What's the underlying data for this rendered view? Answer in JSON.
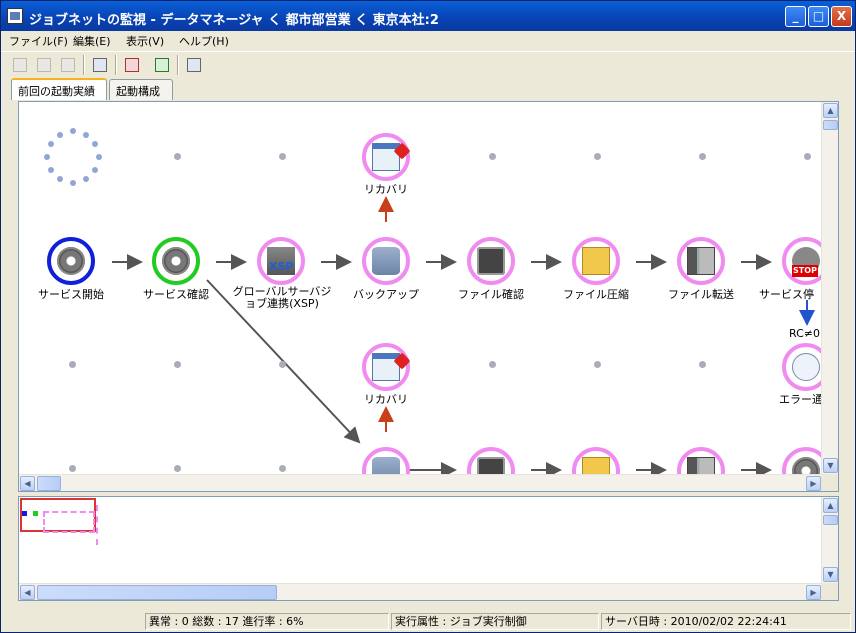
{
  "window": {
    "title": "ジョブネットの監視 - データマネージャ く 都市部営業 く 東京本社:2"
  },
  "title_buttons": {
    "minimize": "_",
    "maximize": "□",
    "close": "X"
  },
  "menu": [
    "ファイル(F)",
    "編集(E)",
    "表示(V)",
    "ヘルプ(H)"
  ],
  "toolbar_icons": [
    "run-icon",
    "copy-icon",
    "properties-icon",
    "search-replace-icon",
    "calendar-icon",
    "refresh-icon",
    "export-icon"
  ],
  "tabs": [
    {
      "label": "前回の起動実績",
      "active": true
    },
    {
      "label": "起動構成",
      "active": false
    }
  ],
  "nodes_row1": [
    {
      "label": "サービス開始",
      "icon": "gear-icon",
      "state": "start"
    },
    {
      "label": "サービス確認",
      "icon": "gear-play-icon",
      "state": "active"
    },
    {
      "label": "グローバルサーバジョブ連携(XSP)",
      "icon": "xsp-server-icon",
      "state": "pending"
    },
    {
      "label": "バックアップ",
      "icon": "database-icon",
      "state": "pending"
    },
    {
      "label": "ファイル確認",
      "icon": "camera-icon",
      "state": "pending"
    },
    {
      "label": "ファイル圧縮",
      "icon": "folder-zip-icon",
      "state": "pending"
    },
    {
      "label": "ファイル転送",
      "icon": "server-transfer-icon",
      "state": "pending"
    },
    {
      "label": "サービス停",
      "icon": "stop-icon",
      "state": "pending"
    }
  ],
  "recovery_nodes": [
    {
      "label": "リカバリ",
      "icon": "recovery-window-icon"
    },
    {
      "label": "リカバリ",
      "icon": "recovery-window-icon"
    }
  ],
  "error_node": {
    "label": "エラー通",
    "icon": "speech-bubble-icon"
  },
  "condition_label": "RC≠0",
  "stop_badge": "STOP",
  "xsp_badge": "XSP",
  "status": {
    "progress": "異常 : 0 総数 : 17 進行率 : 6%",
    "attribute": "実行属性 : ジョブ実行制御",
    "server_time": "サーバ日時 : 2010/02/02 22:24:41"
  },
  "colors": {
    "start_ring": "#1020d8",
    "active_ring": "#22cc22",
    "pending_ring": "#f08cf0",
    "flow_arrow": "#555555",
    "recovery_arrow": "#c8401a",
    "condition_arrow": "#2255cc"
  }
}
